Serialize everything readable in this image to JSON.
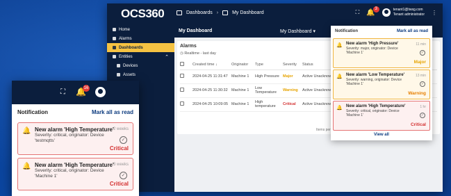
{
  "app": {
    "logo": "OCS360",
    "breadcrumb": [
      "Dashboards",
      "My Dashboard"
    ],
    "user": {
      "email": "tenant1@twsg.com",
      "role": "Tenant administrator"
    },
    "notif_count": "3"
  },
  "sidebar": {
    "items": [
      {
        "label": "Home"
      },
      {
        "label": "Alarms"
      },
      {
        "label": "Dashboards",
        "active": true
      },
      {
        "label": "Entities"
      },
      {
        "label": "Devices"
      },
      {
        "label": "Assets"
      }
    ]
  },
  "dashbar": {
    "title": "My Dashboard",
    "dropdown": "My Dashboard"
  },
  "alarms": {
    "title": "Alarms",
    "realtime": "Realtime - last day",
    "columns": [
      "Created time",
      "Originator",
      "Type",
      "Severity",
      "Status"
    ],
    "rows": [
      {
        "time": "2024-04-25 11:31:47",
        "originator": "Machine 1",
        "type": "High Pressure",
        "severity": "Major",
        "status": "Active Unacknowledged"
      },
      {
        "time": "2024-04-25 11:30:32",
        "originator": "Machine 1",
        "type": "Low Temperature",
        "severity": "Warning",
        "status": "Active Unacknowledged"
      },
      {
        "time": "2024-04-25 10:09:05",
        "originator": "Machine 1",
        "type": "High temperature",
        "severity": "Critical",
        "status": "Active Unacknowledged"
      }
    ],
    "items_label": "Items per"
  },
  "notifications": {
    "title": "Notification",
    "mark_all": "Mark all as read",
    "view_all": "View all",
    "items": [
      {
        "title": "New alarm 'High Pressure'",
        "desc": "Severity: major, originator: Device 'Machine 1'",
        "time": "11 min",
        "severity": "Major",
        "cls": "maj"
      },
      {
        "title": "New alarm 'Low Temperature'",
        "desc": "Severity: warning, originator: Device 'Machine 1'",
        "time": "13 min",
        "severity": "Warning",
        "cls": "warn"
      },
      {
        "title": "New alarm 'High Temperature'",
        "desc": "Severity: critical, originator: Device 'Machine 1'",
        "time": "1 hr",
        "severity": "Critical",
        "cls": "crit"
      }
    ]
  },
  "inset": {
    "title": "Notification",
    "mark_all": "Mark all as read",
    "notif_count": "16",
    "items": [
      {
        "title": "New alarm 'High Temperature'",
        "desc": "Severity: critical, originator: Device 'testmqtts'",
        "time": "2 weeks",
        "severity": "Critical"
      },
      {
        "title": "New alarm 'High Temperature'",
        "desc": "Severity: critical, originator: Device 'Machine 1'",
        "time": "3 weeks",
        "severity": "Critical"
      }
    ]
  }
}
